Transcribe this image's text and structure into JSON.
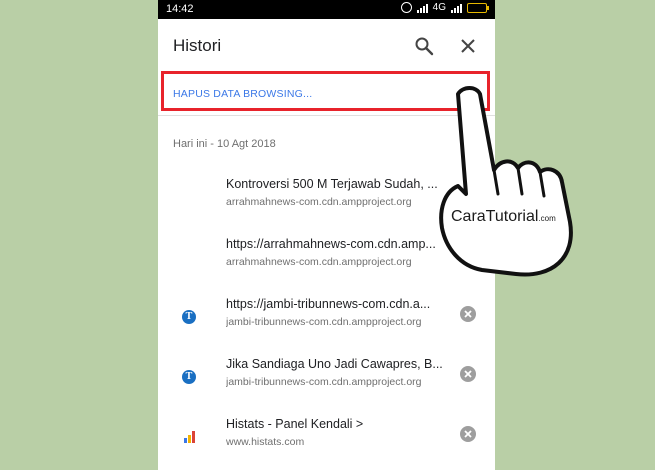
{
  "status_bar": {
    "time": "14:42",
    "network": "4G"
  },
  "app_bar": {
    "title": "Histori"
  },
  "clear_button_label": "HAPUS DATA BROWSING...",
  "date_header": "Hari ini - 10 Agt 2018",
  "history": [
    {
      "title": "Kontroversi 500 M Terjawab Sudah, ...",
      "url": "arrahmahnews-com.cdn.ampproject.org",
      "icon": "none"
    },
    {
      "title": "https://arrahmahnews-com.cdn.amp...",
      "url": "arrahmahnews-com.cdn.ampproject.org",
      "icon": "none"
    },
    {
      "title": "https://jambi-tribunnews-com.cdn.a...",
      "url": "jambi-tribunnews-com.cdn.ampproject.org",
      "icon": "tribun-icon"
    },
    {
      "title": "Jika Sandiaga Uno Jadi Cawapres, B...",
      "url": "jambi-tribunnews-com.cdn.ampproject.org",
      "icon": "tribun-icon"
    },
    {
      "title": "Histats - Panel Kendali >",
      "url": "www.histats.com",
      "icon": "histats-icon"
    }
  ],
  "watermark": {
    "brand": "CaraTutorial",
    "suffix": ".com"
  },
  "colors": {
    "highlight": "#e8232b",
    "link": "#3b78e7",
    "background": "#b9cfa6"
  }
}
